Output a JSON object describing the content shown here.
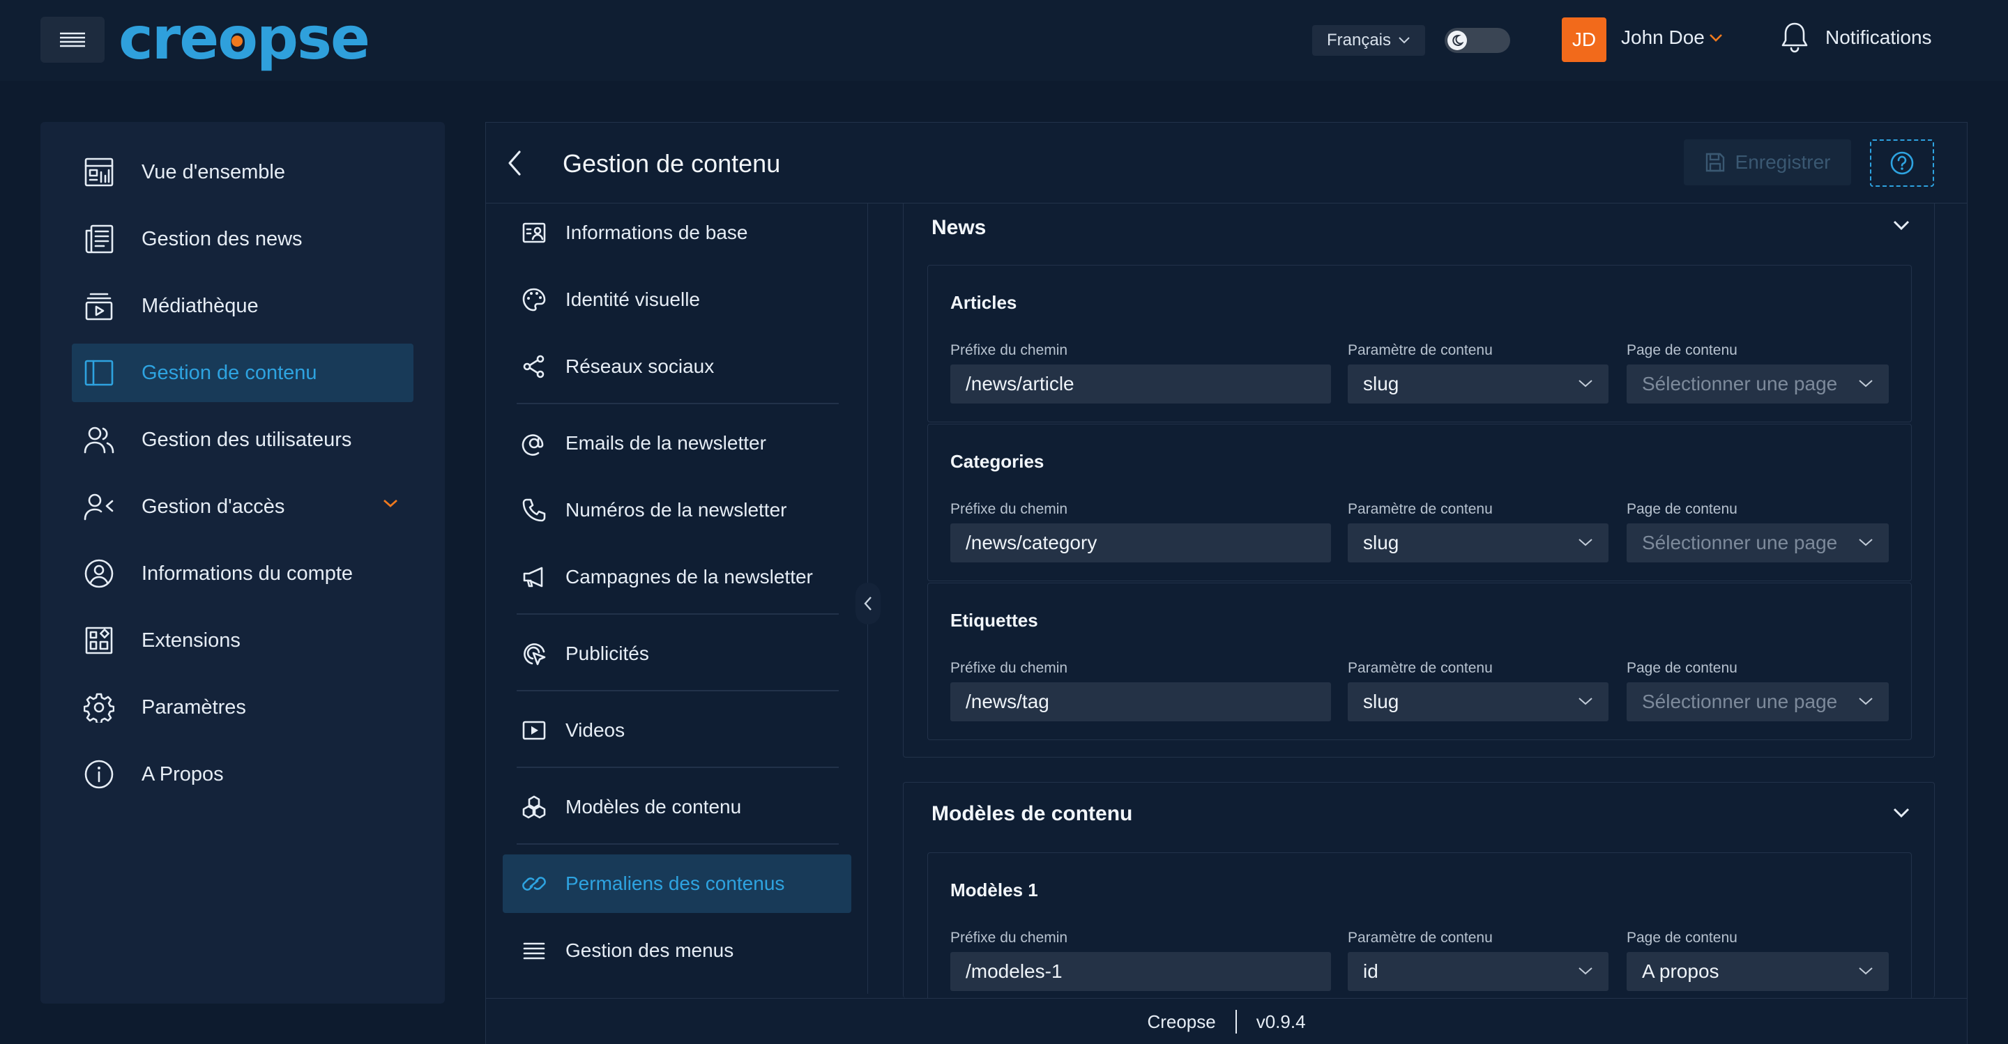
{
  "topbar": {
    "logo_text_a": "cre",
    "logo_text_o": "o",
    "logo_text_b": "pse",
    "language": "Français",
    "avatar_initials": "JD",
    "user_name": "John Doe",
    "notifications_label": "Notifications"
  },
  "sidebar": {
    "items": [
      {
        "label": "Vue d'ensemble",
        "icon": "dashboard-icon"
      },
      {
        "label": "Gestion des news",
        "icon": "newspaper-icon"
      },
      {
        "label": "Médiathèque",
        "icon": "media-library-icon"
      },
      {
        "label": "Gestion de contenu",
        "icon": "layout-icon",
        "active": true
      },
      {
        "label": "Gestion des utilisateurs",
        "icon": "users-icon"
      },
      {
        "label": "Gestion d'accès",
        "icon": "user-access-icon",
        "expandable": true
      },
      {
        "label": "Informations du compte",
        "icon": "user-circle-icon"
      },
      {
        "label": "Extensions",
        "icon": "extensions-icon"
      },
      {
        "label": "Paramètres",
        "icon": "gear-icon"
      },
      {
        "label": "A Propos",
        "icon": "info-icon"
      }
    ]
  },
  "header": {
    "title": "Gestion de contenu",
    "save_label": "Enregistrer"
  },
  "subnav": {
    "items": [
      {
        "label": "Informations de base",
        "icon": "id-card-icon"
      },
      {
        "label": "Identité visuelle",
        "icon": "palette-icon"
      },
      {
        "label": "Réseaux sociaux",
        "icon": "share-icon"
      },
      {
        "label": "Emails de la newsletter",
        "icon": "at-icon"
      },
      {
        "label": "Numéros de la newsletter",
        "icon": "phone-icon"
      },
      {
        "label": "Campagnes de la newsletter",
        "icon": "megaphone-icon"
      },
      {
        "label": "Publicités",
        "icon": "ad-cursor-icon"
      },
      {
        "label": "Videos",
        "icon": "video-icon"
      },
      {
        "label": "Modèles de contenu",
        "icon": "cubes-icon"
      },
      {
        "label": "Permaliens des contenus",
        "icon": "link-icon",
        "active": true
      },
      {
        "label": "Gestion des menus",
        "icon": "menu-list-icon"
      }
    ]
  },
  "content": {
    "field_labels": {
      "path_prefix": "Préfixe du chemin",
      "content_param": "Paramètre de contenu",
      "content_page": "Page de contenu"
    },
    "news": {
      "title": "News",
      "cards": [
        {
          "title": "Articles",
          "path": "/news/article",
          "param": "slug",
          "page": "Sélectionner une page"
        },
        {
          "title": "Categories",
          "path": "/news/category",
          "param": "slug",
          "page": "Sélectionner une page"
        },
        {
          "title": "Etiquettes",
          "path": "/news/tag",
          "param": "slug",
          "page": "Sélectionner une page"
        }
      ]
    },
    "models": {
      "title": "Modèles de contenu",
      "cards": [
        {
          "title": "Modèles 1",
          "path": "/modeles-1",
          "param": "id",
          "page": "A propos"
        }
      ]
    }
  },
  "footer": {
    "brand": "Creopse",
    "version": "v0.9.4"
  },
  "colors": {
    "accent": "#2ea3e0",
    "brand_orange": "#f07a1e",
    "background": "#0d1b2e",
    "active_bg": "#183a58"
  }
}
